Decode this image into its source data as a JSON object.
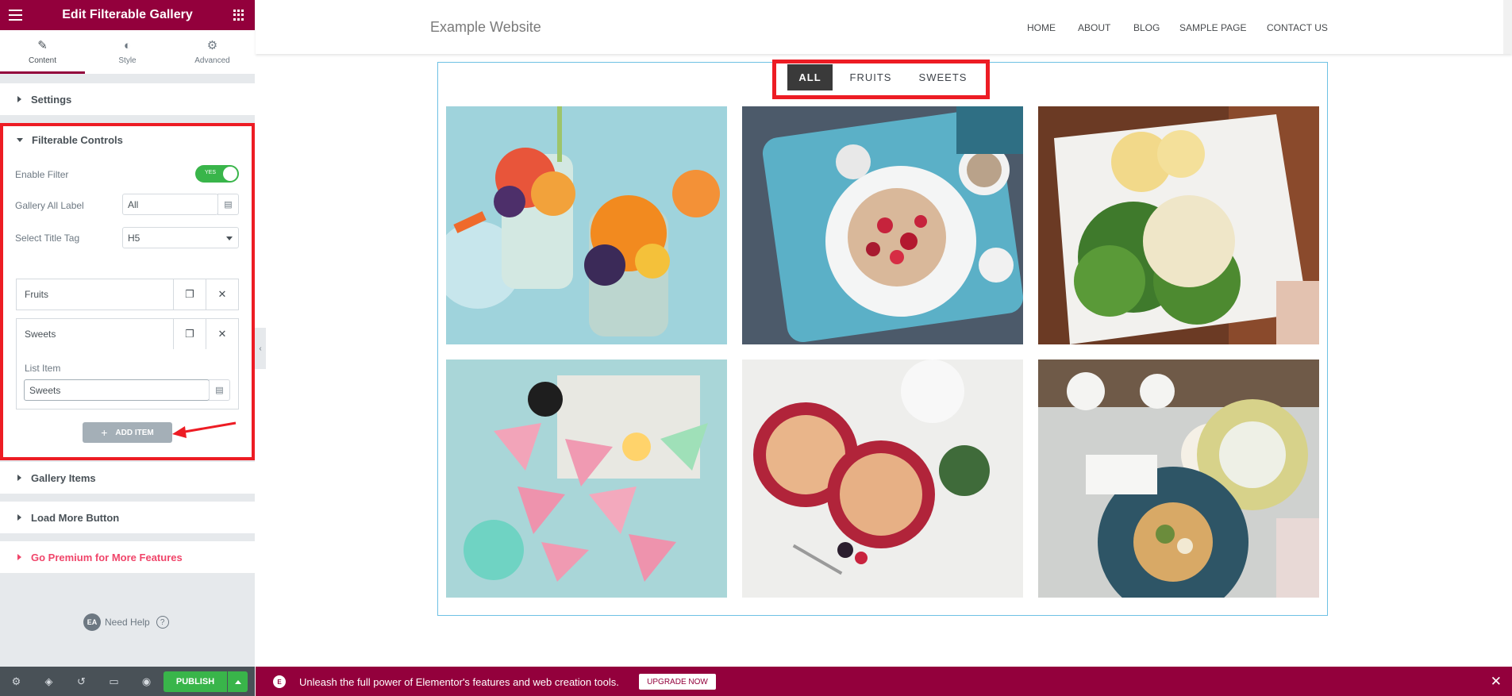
{
  "editor": {
    "title": "Edit Filterable Gallery",
    "tabs": [
      {
        "label": "Content",
        "icon": "pencil-icon"
      },
      {
        "label": "Style",
        "icon": "contrast-icon"
      },
      {
        "label": "Advanced",
        "icon": "gear-icon"
      }
    ],
    "sections": {
      "settings": "Settings",
      "filterable_controls": "Filterable Controls",
      "gallery_items": "Gallery Items",
      "load_more": "Load More Button",
      "premium": "Go Premium for More Features"
    },
    "controls": {
      "enable_filter_label": "Enable Filter",
      "enable_filter_toggle": "YES",
      "gallery_all_label": "Gallery All Label",
      "gallery_all_value": "All",
      "title_tag_label": "Select Title Tag",
      "title_tag_value": "H5"
    },
    "repeater": {
      "items": [
        "Fruits",
        "Sweets"
      ],
      "list_item_label": "List Item",
      "list_item_value": "Sweets",
      "add_button": "ADD ITEM"
    },
    "help": {
      "badge": "EA",
      "label": "Need Help",
      "q": "?"
    },
    "footer": {
      "publish": "PUBLISH"
    }
  },
  "site": {
    "title": "Example Website",
    "nav": [
      "HOME",
      "ABOUT",
      "BLOG",
      "SAMPLE PAGE",
      "CONTACT US"
    ]
  },
  "gallery": {
    "filters": [
      "ALL",
      "FRUITS",
      "SWEETS"
    ],
    "active_filter": "ALL",
    "items": [
      {
        "name": "smoothie-photo"
      },
      {
        "name": "pancake-tray-photo"
      },
      {
        "name": "salad-bun-photo"
      },
      {
        "name": "sprinkle-cake-photo"
      },
      {
        "name": "cherry-pie-photo"
      },
      {
        "name": "open-sandwich-photo"
      }
    ]
  },
  "promo": {
    "logo": "E",
    "message": "Unleash the full power of Elementor's features and web creation tools.",
    "upgrade": "UPGRADE NOW"
  },
  "colors": {
    "brand": "#93003c",
    "highlight": "#ed1c24",
    "toggle_on": "#39b54a",
    "gallery_border": "#6ec1e4"
  }
}
